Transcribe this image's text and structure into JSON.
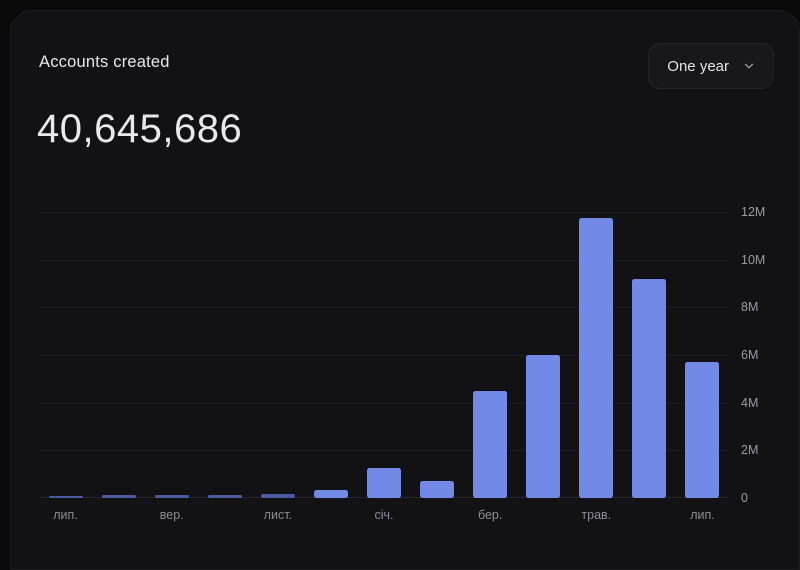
{
  "card": {
    "title": "Accounts created",
    "total_value": "40,645,686"
  },
  "range_select": {
    "label": "One year",
    "icon": "chevron-down-icon"
  },
  "colors": {
    "page_background": "#0a0a0b",
    "card_background": "#121214",
    "bar": "#7389e8",
    "gridline": "#1f1f23",
    "axis_text": "#9a9aa2",
    "title_text": "#e8e8ea"
  },
  "chart_data": {
    "type": "bar",
    "title": "Accounts created",
    "xlabel": "",
    "ylabel": "",
    "ylim": [
      0,
      12000000
    ],
    "grid": true,
    "legend": "none",
    "y_ticks": [
      {
        "value": 0,
        "label": "0"
      },
      {
        "value": 2000000,
        "label": "2M"
      },
      {
        "value": 4000000,
        "label": "4M"
      },
      {
        "value": 6000000,
        "label": "6M"
      },
      {
        "value": 8000000,
        "label": "8M"
      },
      {
        "value": 10000000,
        "label": "10M"
      },
      {
        "value": 12000000,
        "label": "12M"
      }
    ],
    "categories": [
      "лип.",
      "",
      "вер.",
      "",
      "лист.",
      "",
      "січ.",
      "",
      "бер.",
      "",
      "трав.",
      "",
      "лип."
    ],
    "x_tick_labels": [
      "лип.",
      "вер.",
      "лист.",
      "січ.",
      "бер.",
      "трав.",
      "лип."
    ],
    "x_tick_indices": [
      0,
      2,
      4,
      6,
      8,
      10,
      12
    ],
    "values": [
      40000,
      130000,
      130000,
      140000,
      150000,
      340000,
      1270000,
      730000,
      4500000,
      6000000,
      11740000,
      9200000,
      5700000
    ],
    "total_label": "40,645,686"
  }
}
